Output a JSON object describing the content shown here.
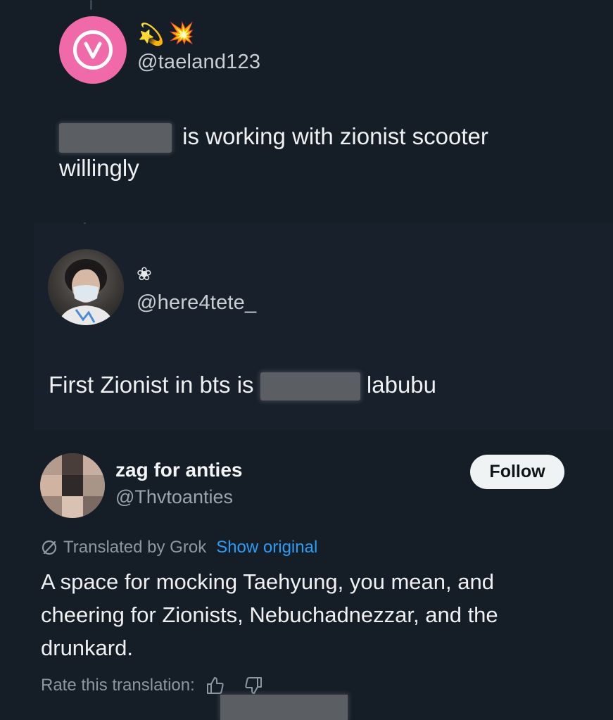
{
  "post1": {
    "display_emoji": [
      "💫",
      "💥"
    ],
    "handle": "@taeland123",
    "text_after_redaction": " is working with zionist scooter",
    "text_line2": "willingly"
  },
  "post2": {
    "display_emoji": "❀",
    "handle": "@here4tete_",
    "text_before_redaction": "First Zionist in bts is ",
    "text_after_redaction": " labubu"
  },
  "profile": {
    "name": "zag for anties",
    "username": "@Thvtoanties",
    "follow_label": "Follow",
    "translated_label": "Translated by Grok",
    "show_original_label": "Show original",
    "bio": "A space for mocking Taehyung, you mean, and cheering for Zionists, Nebuchadnezzar, and the drunkard.",
    "rate_label": "Rate this translation:"
  },
  "colors": {
    "background": "#151d27",
    "avatar_pink": "#f06aa9",
    "link_blue": "#2a9df4",
    "follow_button_bg": "#eff3f4"
  },
  "icons": [
    "translate-icon",
    "thumbs-up-icon",
    "thumbs-down-icon",
    "v-logo-icon"
  ]
}
